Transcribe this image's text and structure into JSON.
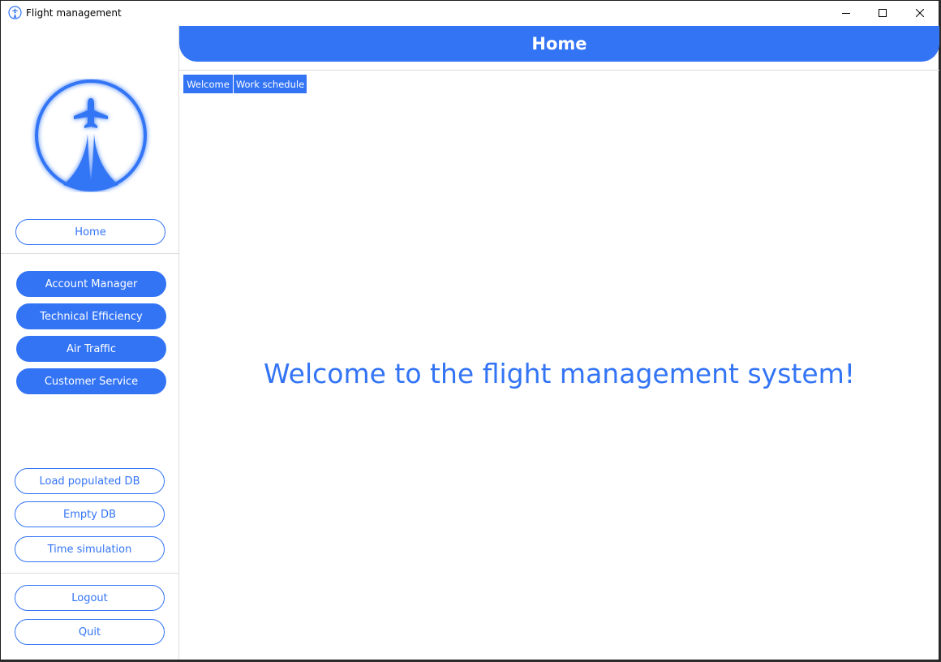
{
  "window": {
    "title": "Flight management",
    "controls": [
      "minimize-icon",
      "maximize-icon",
      "close-icon"
    ]
  },
  "header": {
    "title": "Home"
  },
  "sidebar": {
    "logo_icon": "airplane-logo-icon",
    "home_button": "Home",
    "modules": [
      "Account Manager",
      "Technical Efficiency",
      "Air Traffic",
      "Customer Service"
    ],
    "db_actions": [
      "Load populated DB",
      "Empty DB",
      "Time simulation"
    ],
    "session_actions": [
      "Logout",
      "Quit"
    ]
  },
  "tabs": [
    "Welcome",
    "Work schedule"
  ],
  "main": {
    "welcome_text": "Welcome to the flight management system!"
  },
  "colors": {
    "accent": "#3374f5",
    "background": "#ffffff",
    "divider": "#dcdcdc"
  }
}
